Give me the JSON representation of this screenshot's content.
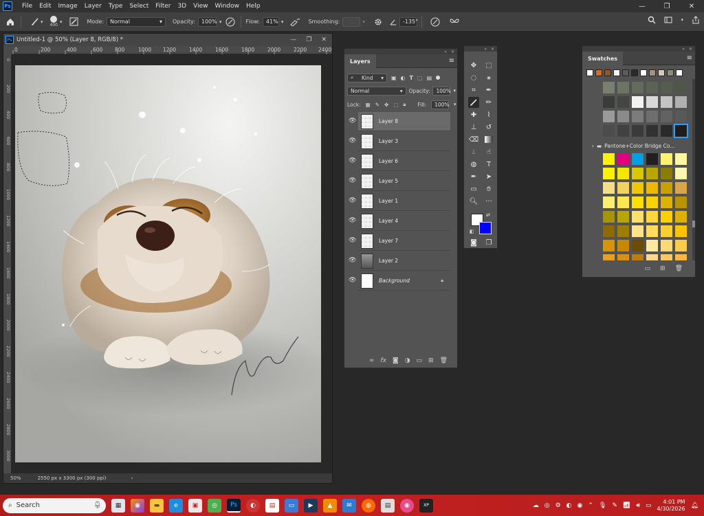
{
  "menubar": {
    "items": [
      "File",
      "Edit",
      "Image",
      "Layer",
      "Type",
      "Select",
      "Filter",
      "3D",
      "View",
      "Window",
      "Help"
    ]
  },
  "options": {
    "brush_size": "400",
    "mode_label": "Mode:",
    "mode_value": "Normal",
    "opacity_label": "Opacity:",
    "opacity_value": "100%",
    "flow_label": "Flow:",
    "flow_value": "41%",
    "smoothing_label": "Smoothing:",
    "smoothing_value": "",
    "angle_value": "-135°"
  },
  "document": {
    "title": "Untitled-1 @ 50% (Layer 8, RGB/8) *",
    "ruler_h": [
      "0",
      "200",
      "400",
      "600",
      "800",
      "1000",
      "1200",
      "1400",
      "1600",
      "1800",
      "2000",
      "2200",
      "2400"
    ],
    "ruler_v": [
      "0",
      "200",
      "400",
      "600",
      "800",
      "1000",
      "1200",
      "1400",
      "1600",
      "1800",
      "2000",
      "2200",
      "2400",
      "2600",
      "2800",
      "3000",
      "3200"
    ],
    "zoom": "50%",
    "doc_info": "2550 px x 3300 px (300 ppi)",
    "status_arrow": "›"
  },
  "layers_panel": {
    "tab": "Layers",
    "kind_label": "Kind",
    "blend_mode": "Normal",
    "opacity_label": "Opacity:",
    "opacity_value": "100%",
    "lock_label": "Lock:",
    "fill_label": "Fill:",
    "fill_value": "100%",
    "layers": [
      {
        "name": "Layer 8",
        "selected": true
      },
      {
        "name": "Layer 3"
      },
      {
        "name": "Layer 6"
      },
      {
        "name": "Layer 5"
      },
      {
        "name": "Layer 1"
      },
      {
        "name": "Layer 4"
      },
      {
        "name": "Layer 7"
      },
      {
        "name": "Layer 2"
      },
      {
        "name": "Background",
        "locked": true
      }
    ]
  },
  "swatches_panel": {
    "tab": "Swatches",
    "recent_colors": [
      "#ffffff",
      "#d86c1c",
      "#8a5a2a",
      "#f4f4f4",
      "#5c5c5c",
      "#2a2a2a",
      "#ffffff",
      "#a89080",
      "#d8c8b8",
      "#8c8c7c",
      "#ffffff"
    ],
    "group_name": "Pantone+Color Bridge Co...",
    "grey_rows": [
      [
        "#7a8070",
        "#6e7464",
        "#646a5c",
        "#5c6256",
        "#565c50",
        "#505648"
      ],
      [
        "#3a3c38",
        "#444642",
        "#f2f2f2",
        "#d8d8d8",
        "#c4c4c4",
        "#b0b0b0"
      ],
      [
        "#9a9a9a",
        "#8a8a8a",
        "#7c7c7c",
        "#6e6e6e",
        "#626262",
        "#585858"
      ],
      [
        "#4c4c4c",
        "#424242",
        "#3a3a3a",
        "#323232",
        "#2a2a2a",
        "#1e1e1e"
      ]
    ],
    "pantone_rows": [
      [
        "#fff200",
        "#e4007c",
        "#00a0e9",
        "#231f20",
        "#fff36b",
        "#fff8a0"
      ],
      [
        "#fff200",
        "#f7e600",
        "#d9c800",
        "#b9a700",
        "#8a7d00",
        "#fff7b0"
      ],
      [
        "#f5de85",
        "#f2d25e",
        "#f0c800",
        "#eeb800",
        "#c8a000",
        "#d9a44a"
      ],
      [
        "#fef06c",
        "#fde94c",
        "#fbe000",
        "#f8d400",
        "#dcb400",
        "#b89400"
      ],
      [
        "#a89400",
        "#b8a600",
        "#ffe066",
        "#ffd83a",
        "#ffd000",
        "#e0b000"
      ],
      [
        "#8c6c00",
        "#9e7e00",
        "#ffe48a",
        "#ffdb5e",
        "#ffcf2e",
        "#ffc400"
      ],
      [
        "#d89400",
        "#c78800",
        "#6c4c00",
        "#ffe8a0",
        "#ffda70",
        "#ffcc4a"
      ],
      [
        "#e8a020",
        "#d89018",
        "#bc7c10",
        "#ffd890",
        "#ffc860",
        "#ffb840"
      ]
    ]
  },
  "taskbar": {
    "search_placeholder": "Search",
    "time": "4:01 PM",
    "date": "4/30/2026"
  }
}
